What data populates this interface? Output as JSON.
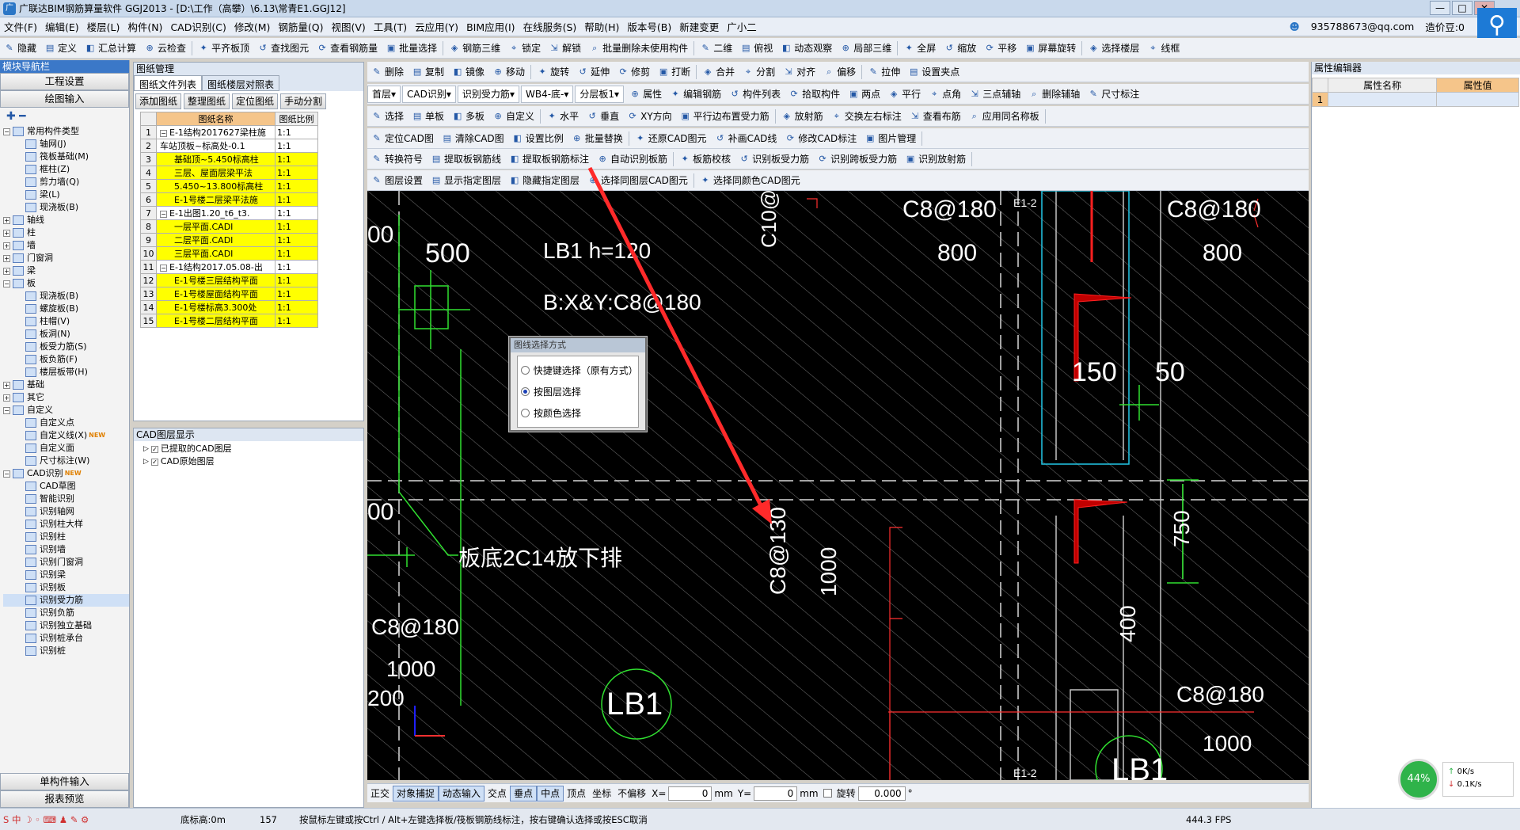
{
  "window": {
    "title": "广联达BIM钢筋算量软件 GGJ2013 - [D:\\工作（高攀）\\6.13\\常青E1.GGJ12]",
    "min": "—",
    "max": "□",
    "close": "✕"
  },
  "menu": [
    "文件(F)",
    "编辑(E)",
    "楼层(L)",
    "构件(N)",
    "CAD识别(C)",
    "修改(M)",
    "钢筋量(Q)",
    "视图(V)",
    "工具(T)",
    "云应用(Y)",
    "BIM应用(I)",
    "在线服务(S)",
    "帮助(H)",
    "版本号(B)",
    "新建变更",
    "广小二"
  ],
  "account": {
    "email": "935788673@qq.com",
    "bean": "造价豆:0"
  },
  "toolbar1": [
    "隐藏",
    "定义",
    "汇总计算",
    "云检查",
    "平齐板顶",
    "查找图元",
    "查看钢筋量",
    "批量选择",
    "钢筋三维",
    "锁定",
    "解锁",
    "批量删除未使用构件",
    "二维",
    "俯视",
    "动态观察",
    "局部三维",
    "全屏",
    "缩放",
    "平移",
    "屏幕旋转",
    "选择楼层",
    "线框"
  ],
  "nav": {
    "title": "模块导航栏",
    "btn1": "工程设置",
    "btn2": "绘图输入",
    "btn3": "单构件输入",
    "btn4": "报表预览",
    "tree": [
      {
        "t": "常用构件类型",
        "l": 0,
        "ex": "−"
      },
      {
        "t": "轴网(J)",
        "l": 2
      },
      {
        "t": "筏板基础(M)",
        "l": 2
      },
      {
        "t": "框柱(Z)",
        "l": 2
      },
      {
        "t": "剪力墙(Q)",
        "l": 2
      },
      {
        "t": "梁(L)",
        "l": 2
      },
      {
        "t": "现浇板(B)",
        "l": 2
      },
      {
        "t": "轴线",
        "l": 0,
        "ex": "+"
      },
      {
        "t": "柱",
        "l": 0,
        "ex": "+"
      },
      {
        "t": "墙",
        "l": 0,
        "ex": "+"
      },
      {
        "t": "门窗洞",
        "l": 0,
        "ex": "+"
      },
      {
        "t": "梁",
        "l": 0,
        "ex": "+"
      },
      {
        "t": "板",
        "l": 0,
        "ex": "−"
      },
      {
        "t": "现浇板(B)",
        "l": 2
      },
      {
        "t": "螺旋板(B)",
        "l": 2
      },
      {
        "t": "柱帽(V)",
        "l": 2
      },
      {
        "t": "板洞(N)",
        "l": 2
      },
      {
        "t": "板受力筋(S)",
        "l": 2
      },
      {
        "t": "板负筋(F)",
        "l": 2
      },
      {
        "t": "楼层板带(H)",
        "l": 2
      },
      {
        "t": "基础",
        "l": 0,
        "ex": "+"
      },
      {
        "t": "其它",
        "l": 0,
        "ex": "+"
      },
      {
        "t": "自定义",
        "l": 0,
        "ex": "−"
      },
      {
        "t": "自定义点",
        "l": 2
      },
      {
        "t": "自定义线(X)",
        "l": 2,
        "badge": "NEW"
      },
      {
        "t": "自定义面",
        "l": 2
      },
      {
        "t": "尺寸标注(W)",
        "l": 2
      },
      {
        "t": "CAD识别",
        "l": 0,
        "ex": "−",
        "badge": "NEW"
      },
      {
        "t": "CAD草图",
        "l": 2
      },
      {
        "t": "智能识别",
        "l": 2
      },
      {
        "t": "识别轴网",
        "l": 2
      },
      {
        "t": "识别柱大样",
        "l": 2
      },
      {
        "t": "识别柱",
        "l": 2
      },
      {
        "t": "识别墙",
        "l": 2
      },
      {
        "t": "识别门窗洞",
        "l": 2
      },
      {
        "t": "识别梁",
        "l": 2
      },
      {
        "t": "识别板",
        "l": 2
      },
      {
        "t": "识别受力筋",
        "l": 2,
        "sel": true
      },
      {
        "t": "识别负筋",
        "l": 2
      },
      {
        "t": "识别独立基础",
        "l": 2
      },
      {
        "t": "识别桩承台",
        "l": 2
      },
      {
        "t": "识别桩",
        "l": 2
      }
    ]
  },
  "drawings": {
    "title": "图纸管理",
    "tab1": "图纸文件列表",
    "tab2": "图纸楼层对照表",
    "btns": [
      "添加图纸",
      "整理图纸",
      "定位图纸",
      "手动分割"
    ],
    "col_name": "图纸名称",
    "col_scale": "图纸比例",
    "rows": [
      {
        "n": "1",
        "ex": "−",
        "name": "E-1结构2017627梁柱施",
        "scale": "1:1",
        "y": false
      },
      {
        "n": "2",
        "name": "车站顶板~标高处-0.1",
        "scale": "1:1",
        "y": false
      },
      {
        "n": "3",
        "name": "基础顶~5.450标高柱",
        "scale": "1:1",
        "y": true
      },
      {
        "n": "4",
        "name": "三层、屋面层梁平法",
        "scale": "1:1",
        "y": true
      },
      {
        "n": "5",
        "name": "5.450~13.800标高柱",
        "scale": "1:1",
        "y": true
      },
      {
        "n": "6",
        "name": "E-1号楼二层梁平法施",
        "scale": "1:1",
        "y": true
      },
      {
        "n": "7",
        "ex": "−",
        "name": "E-1出图1.20_t6_t3.",
        "scale": "1:1",
        "y": false
      },
      {
        "n": "8",
        "name": "一层平面.CADI",
        "scale": "1:1",
        "y": true
      },
      {
        "n": "9",
        "name": "二层平面.CADI",
        "scale": "1:1",
        "y": true
      },
      {
        "n": "10",
        "name": "三层平面.CADI",
        "scale": "1:1",
        "y": true
      },
      {
        "n": "11",
        "ex": "−",
        "name": "E-1结构2017.05.08-出",
        "scale": "1:1",
        "y": false
      },
      {
        "n": "12",
        "name": "E-1号楼三层结构平面",
        "scale": "1:1",
        "y": true
      },
      {
        "n": "13",
        "name": "E-1号楼屋面结构平面",
        "scale": "1:1",
        "y": true
      },
      {
        "n": "14",
        "name": "E-1号楼标高3.300处",
        "scale": "1:1",
        "y": true
      },
      {
        "n": "15",
        "name": "E-1号楼二层结构平面",
        "scale": "1:1",
        "y": true
      }
    ]
  },
  "layers": {
    "title": "CAD图层显示",
    "items": [
      "已提取的CAD图层",
      "CAD原始图层"
    ]
  },
  "edit_tb": [
    "删除",
    "复制",
    "镜像",
    "移动",
    "旋转",
    "延伸",
    "修剪",
    "打断",
    "合并",
    "分割",
    "对齐",
    "偏移",
    "拉伸",
    "设置夹点"
  ],
  "sel_tb": {
    "floor": "首层",
    "cad": "CAD识别",
    "type": "识别受力筋",
    "comp": "WB4-底-",
    "layer": "分层板1",
    "items": [
      "属性",
      "编辑钢筋",
      "构件列表",
      "拾取构件",
      "两点",
      "平行",
      "点角",
      "三点辅轴",
      "删除辅轴",
      "尺寸标注"
    ]
  },
  "draw_tb": [
    "选择",
    "单板",
    "多板",
    "自定义",
    "水平",
    "垂直",
    "XY方向",
    "平行边布置受力筋",
    "放射筋",
    "交换左右标注",
    "查看布筋",
    "应用同名称板"
  ],
  "cad_tb1": [
    "定位CAD图",
    "清除CAD图",
    "设置比例",
    "批量替换",
    "还原CAD图元",
    "补画CAD线",
    "修改CAD标注",
    "图片管理"
  ],
  "cad_tb2": [
    "转换符号",
    "提取板钢筋线",
    "提取板钢筋标注",
    "自动识别板筋",
    "板筋校核",
    "识别板受力筋",
    "识别跨板受力筋",
    "识别放射筋"
  ],
  "cad_tb3": [
    "图层设置",
    "显示指定图层",
    "隐藏指定图层",
    "选择同图层CAD图元",
    "选择同颜色CAD图元"
  ],
  "dialog": {
    "title": "图线选择方式",
    "opts": [
      "快捷键选择（原有方式）",
      "按图层选择",
      "按颜色选择"
    ],
    "selected": 1
  },
  "canvas_text": {
    "c1": "C8@180",
    "c2": "C8@180",
    "d800a": "800",
    "d800b": "800",
    "lb1h": "LB1 h=120",
    "bxy": "B:X&Y:C8@180",
    "d500": "500",
    "d150": "150",
    "d50": "50",
    "c10": "C10@",
    "e12a": "E1-2",
    "e12b": "E1-2",
    "c130": "C8@130",
    "d1000a": "1000",
    "d750": "750",
    "d400": "400",
    "bottom": "板底2C14放下排",
    "c3": "C8@180",
    "d1000b": "1000",
    "d200": "200",
    "d00a": "00",
    "d00b": "00",
    "lb1": "LB1",
    "c4": "C8@180",
    "d1000c": "1000",
    "lb1b": "LB1"
  },
  "snap": [
    "正交",
    "对象捕捉",
    "动态输入",
    "交点",
    "垂点",
    "中点",
    "顶点",
    "坐标",
    "不偏移"
  ],
  "coords": {
    "x_label": "X=",
    "x": "0",
    "mm1": "mm",
    "y_label": "Y=",
    "y": "0",
    "mm2": "mm",
    "rot": "旋转",
    "rot_val": "0.000",
    "deg": "°"
  },
  "status": {
    "elev": "底标高:0m",
    "num": "157",
    "hint": "按鼠标左键或按Ctrl / Alt+左键选择板/筏板钢筋线标注，按右键确认选择或按ESC取消",
    "fps": "444.3 FPS"
  },
  "props": {
    "title": "属性编辑器",
    "col1": "属性名称",
    "col2": "属性值",
    "row1": "1"
  },
  "net": {
    "pct": "44%",
    "up": "0K/s",
    "down": "0.1K/s"
  },
  "colors": {
    "yellow": "#ffff00",
    "navy": "#3b78c8",
    "canvas": "#000000"
  }
}
